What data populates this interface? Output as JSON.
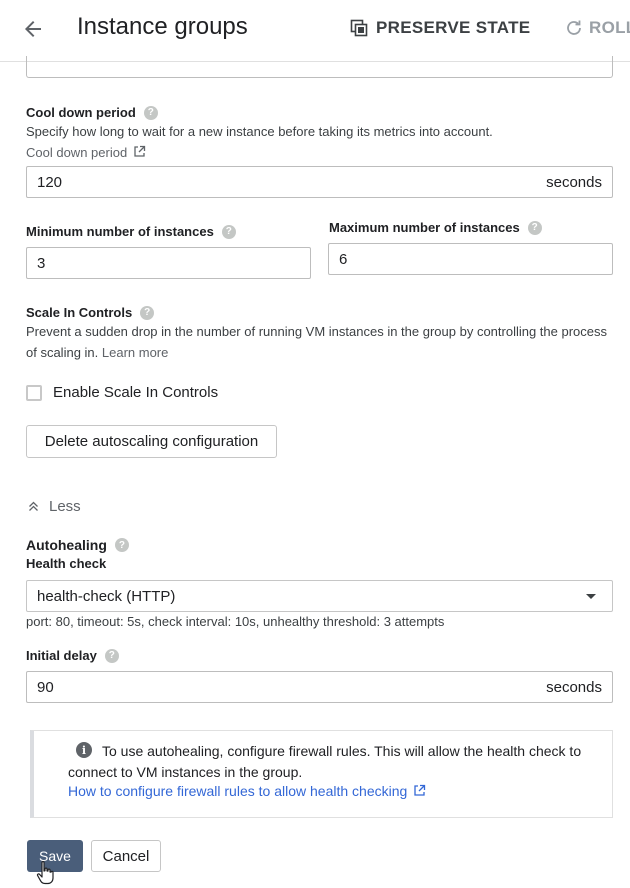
{
  "header": {
    "title": "Instance groups",
    "preserve_state_label": "PRESERVE STATE",
    "roll_label": "ROLL"
  },
  "cooldown": {
    "label": "Cool down period",
    "description": "Specify how long to wait for a new instance before taking its metrics into account.",
    "link": "Cool down period",
    "value": "120",
    "unit": "seconds"
  },
  "instances": {
    "min_label": "Minimum number of instances",
    "min_value": "3",
    "max_label": "Maximum number of instances",
    "max_value": "6"
  },
  "scale_in": {
    "label": "Scale In Controls",
    "description": "Prevent a sudden drop in the number of running VM instances in the group by controlling the process of scaling in.",
    "learn_more": "Learn more",
    "checkbox_label": "Enable Scale In Controls",
    "checked": false
  },
  "delete_button": "Delete autoscaling configuration",
  "less_label": "Less",
  "autohealing": {
    "label": "Autohealing",
    "health_check_label": "Health check",
    "health_check_value": "health-check (HTTP)",
    "health_check_details": "port: 80, timeout: 5s, check interval: 10s, unhealthy threshold: 3 attempts",
    "initial_delay_label": "Initial delay",
    "initial_delay_value": "90",
    "initial_delay_unit": "seconds"
  },
  "info": {
    "text": "To use autohealing, configure firewall rules. This will allow the health check to connect to VM instances in the group.",
    "link": "How to configure firewall rules to allow health checking"
  },
  "actions": {
    "save": "Save",
    "cancel": "Cancel"
  },
  "icons": {
    "help": "?",
    "info": "i"
  }
}
